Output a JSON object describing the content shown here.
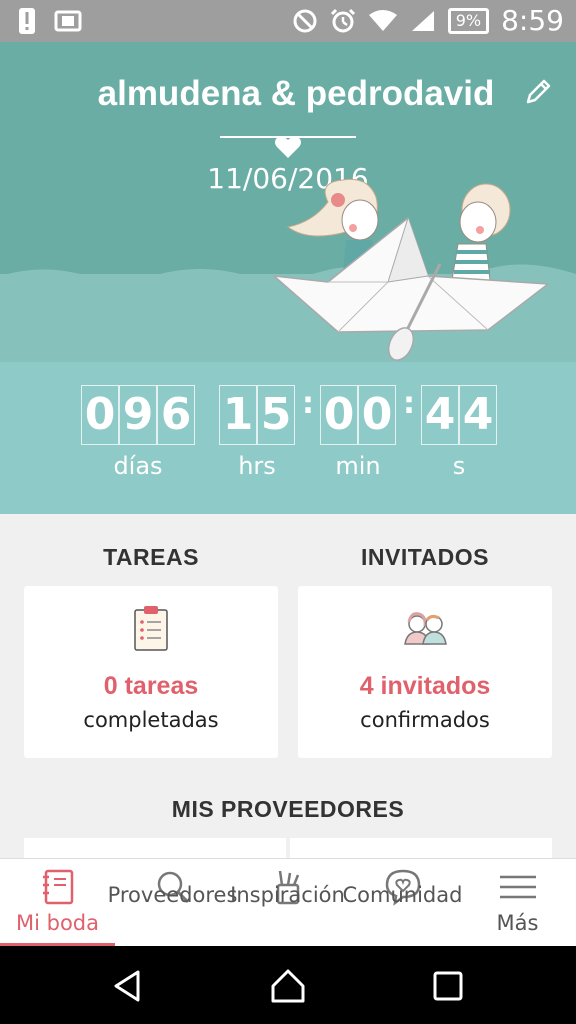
{
  "status_bar": {
    "battery": "9%",
    "time": "8:59"
  },
  "header": {
    "couple_names": "almudena & pedrodavid",
    "wedding_date": "11/06/2016"
  },
  "countdown": {
    "days": "096",
    "hours": "15",
    "minutes": "00",
    "seconds": "44",
    "labels": {
      "days": "días",
      "hours": "hrs",
      "minutes": "min",
      "seconds": "s"
    }
  },
  "tasks": {
    "title": "TAREAS",
    "count": "0 tareas",
    "sub": "completadas"
  },
  "guests": {
    "title": "INVITADOS",
    "count": "4 invitados",
    "sub": "confirmados"
  },
  "providers": {
    "title": "MIS PROVEEDORES"
  },
  "bottom_nav": {
    "items": [
      {
        "label": "Mi boda",
        "icon": "notebook-icon",
        "active": true
      },
      {
        "label": "Proveedores",
        "icon": "search-icon",
        "active": false
      },
      {
        "label": "Inspiración",
        "icon": "pencils-icon",
        "active": false
      },
      {
        "label": "Comunidad",
        "icon": "chat-heart-icon",
        "active": false
      },
      {
        "label": "Más",
        "icon": "menu-icon",
        "active": false
      }
    ]
  },
  "colors": {
    "header_bg": "#6aada5",
    "countdown_bg": "#8ecac7",
    "accent": "#e0616b"
  }
}
